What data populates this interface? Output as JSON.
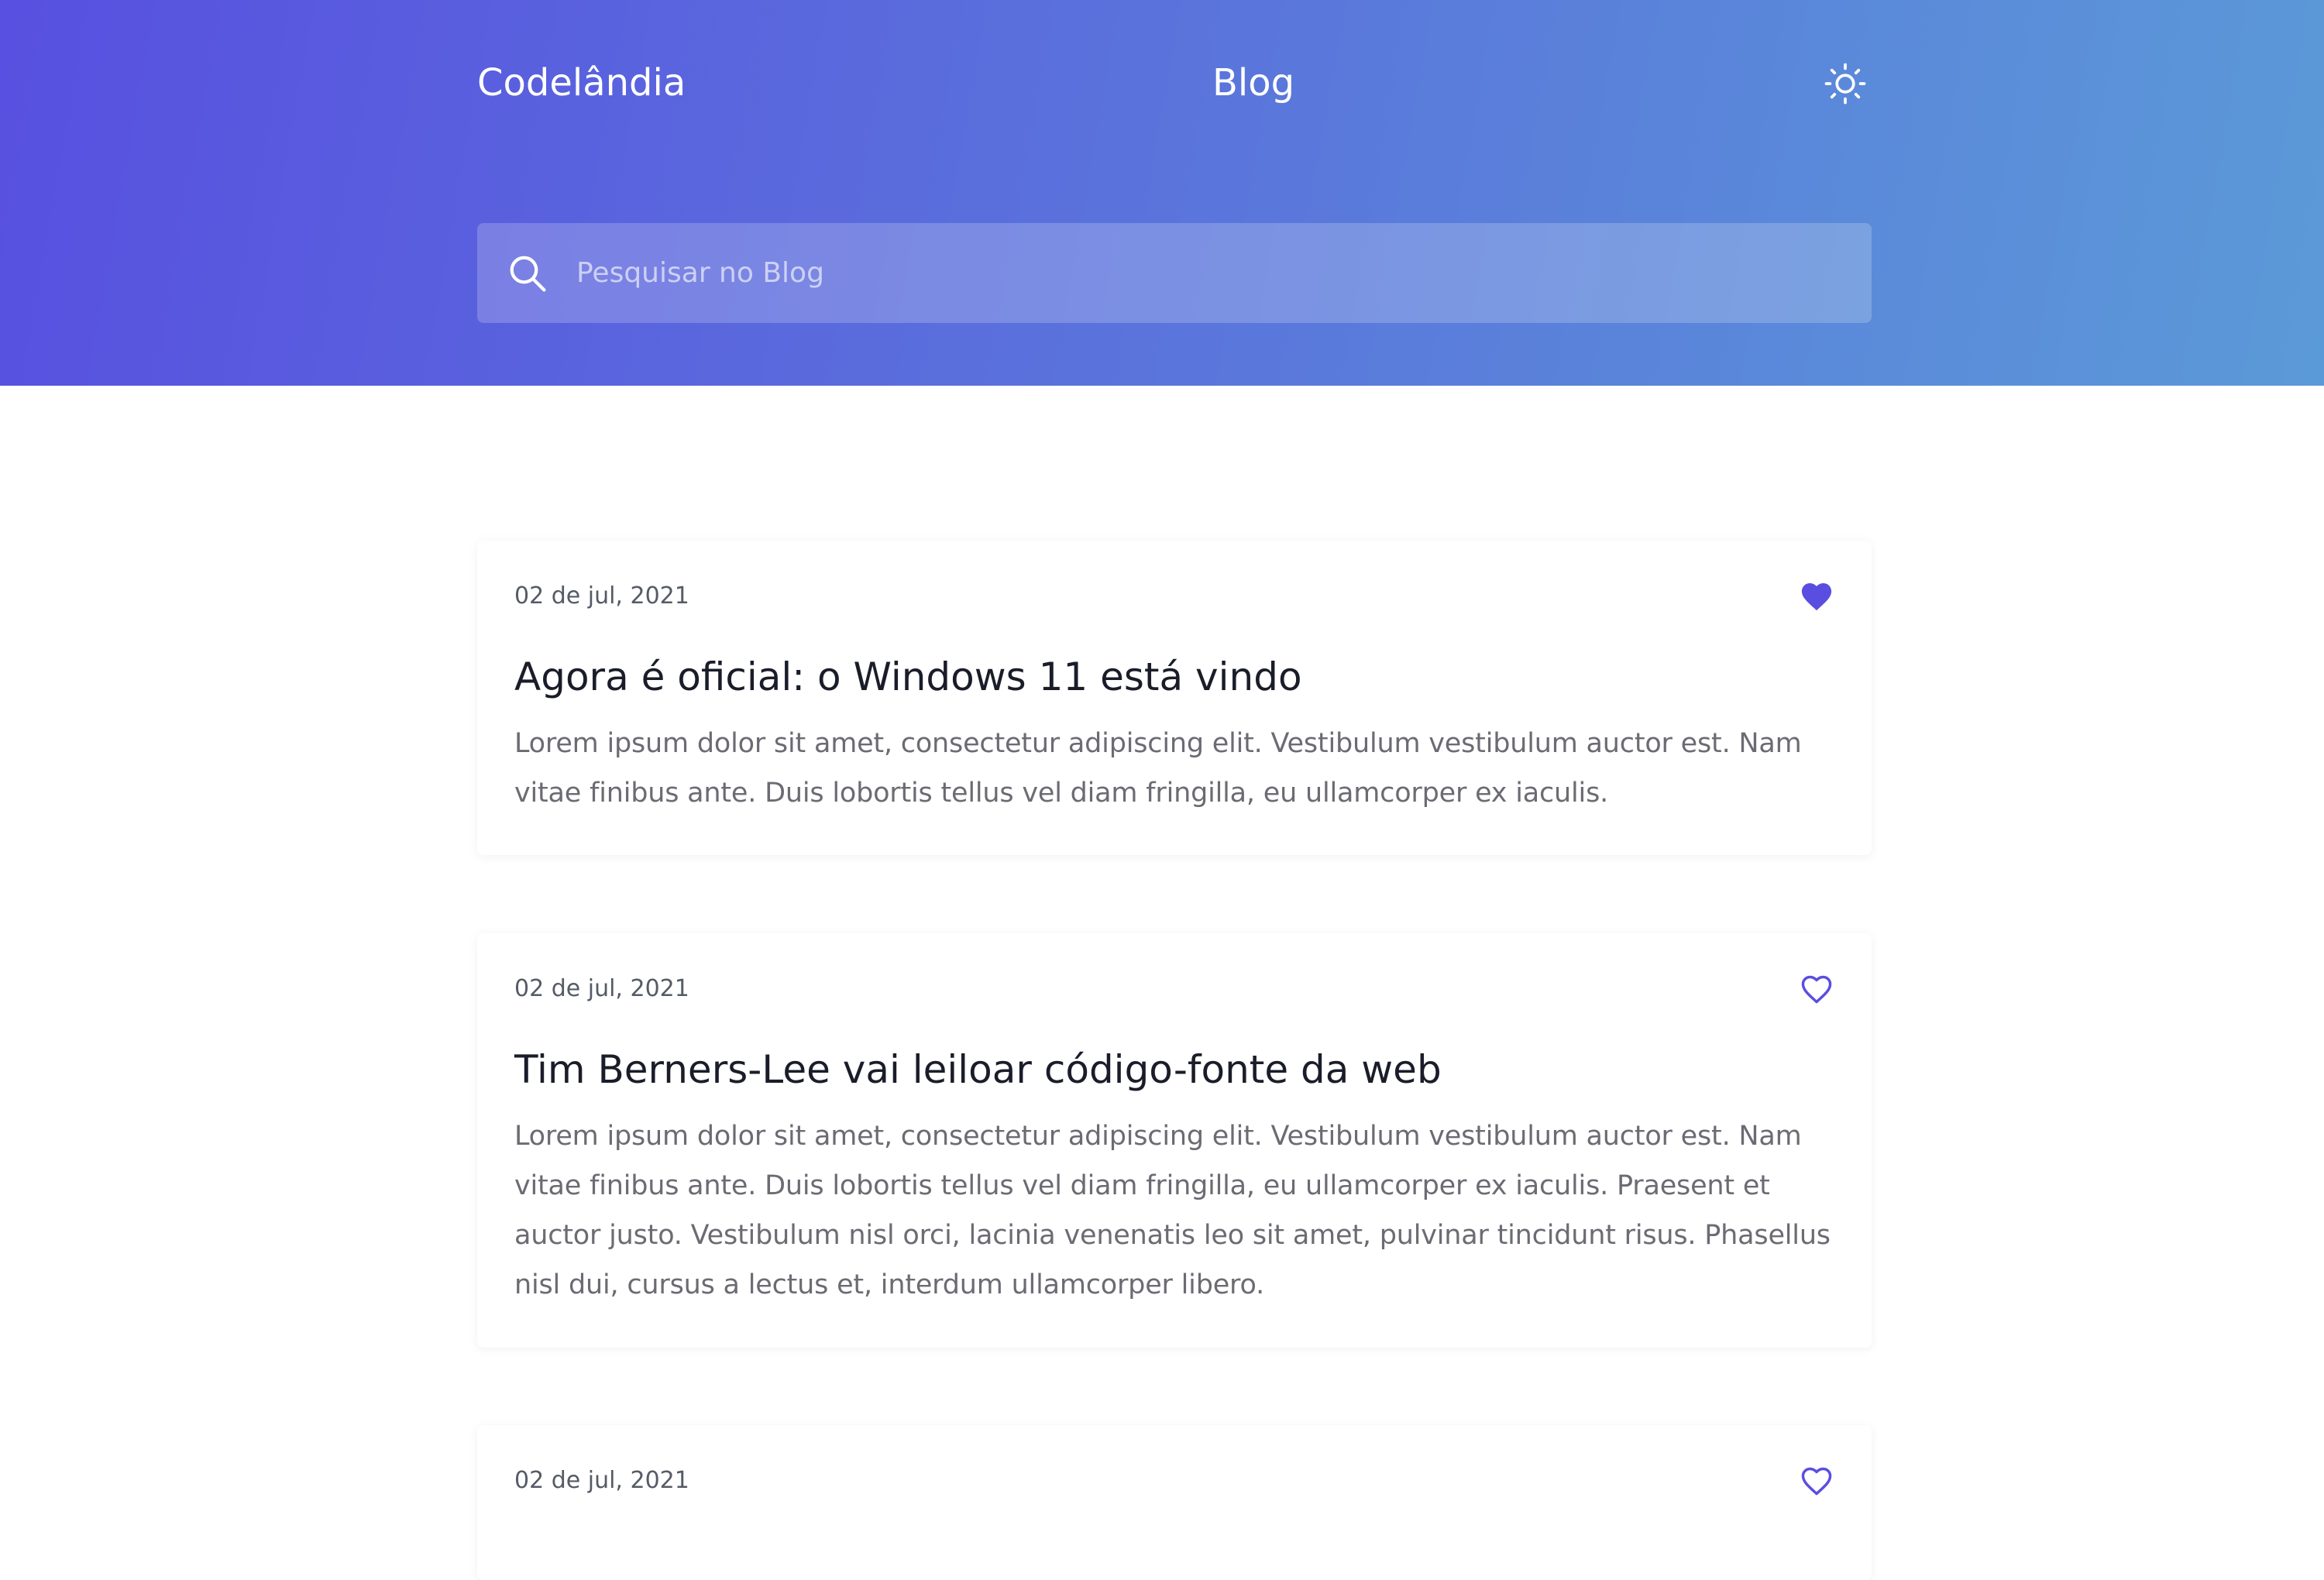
{
  "header": {
    "brand": "Codelândia",
    "nav_title": "Blog",
    "theme_icon": "sun-icon"
  },
  "search": {
    "placeholder": "Pesquisar no Blog",
    "value": "",
    "icon": "search-icon"
  },
  "colors": {
    "gradient_start": "#5850e0",
    "gradient_end": "#5b9ad8",
    "accent": "#5a4ee0",
    "title_text": "#1a1d29",
    "body_text": "#6b6b73"
  },
  "posts": [
    {
      "date": "02 de jul, 2021",
      "title": "Agora é oficial: o Windows 11 está vindo",
      "excerpt": "Lorem ipsum dolor sit amet, consectetur adipiscing elit. Vestibulum vestibulum auctor est. Nam vitae finibus ante. Duis lobortis tellus vel diam fringilla, eu ullamcorper ex iaculis.",
      "liked": true
    },
    {
      "date": "02 de jul, 2021",
      "title": "Tim Berners-Lee vai leiloar código-fonte da web",
      "excerpt": "Lorem ipsum dolor sit amet, consectetur adipiscing elit. Vestibulum vestibulum auctor est. Nam vitae finibus ante. Duis lobortis tellus vel diam fringilla, eu ullamcorper ex iaculis. Praesent et auctor justo. Vestibulum nisl orci, lacinia venenatis leo sit amet, pulvinar tincidunt risus. Phasellus nisl dui, cursus a lectus et, interdum ullamcorper libero.",
      "liked": false
    },
    {
      "date": "02 de jul, 2021",
      "title": "",
      "excerpt": "",
      "liked": false
    }
  ]
}
